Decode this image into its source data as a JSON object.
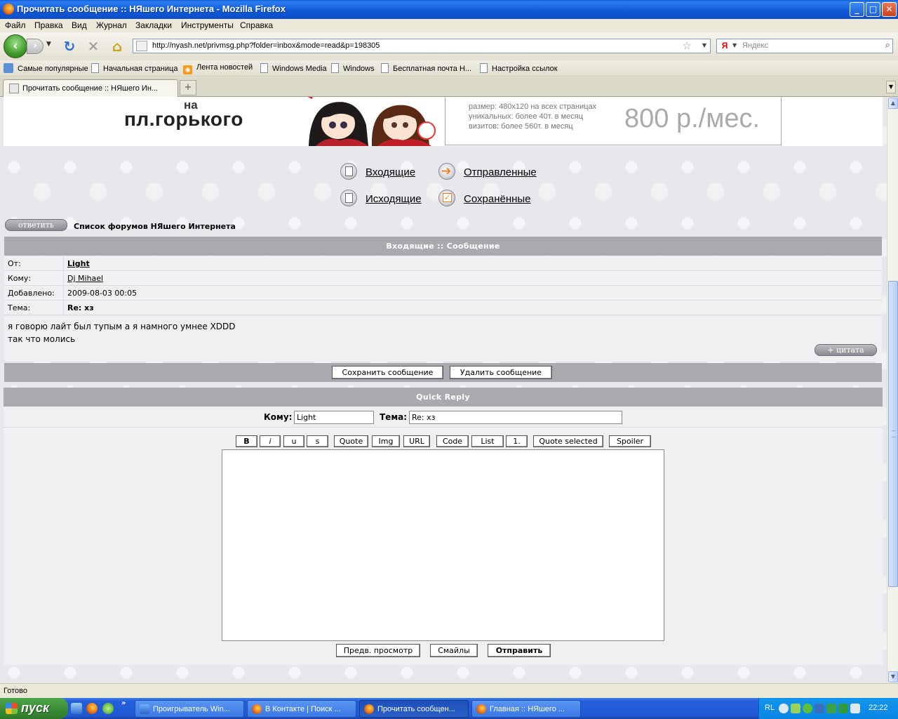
{
  "window": {
    "title": "Прочитать сообщение :: НЯшего Интернета - Mozilla Firefox",
    "min": "_",
    "max": "□",
    "close": "✕"
  },
  "menu": [
    "Файл",
    "Правка",
    "Вид",
    "Журнал",
    "Закладки",
    "Инструменты",
    "Справка"
  ],
  "nav": {
    "url": "http://nyash.net/privmsg.php?folder=inbox&mode=read&p=198305",
    "search_placeholder": "Яндекс",
    "search_engine": "Я"
  },
  "bookmarks": [
    "Самые популярные",
    "Начальная страница",
    "Лента новостей",
    "Windows Media",
    "Windows",
    "Бесплатная почта Н...",
    "Настройка ссылок"
  ],
  "tab": {
    "title": "Прочитать сообщение :: НЯшего Ин...",
    "new_tab": "+"
  },
  "banner": {
    "na": "на",
    "place": "пл.горького",
    "ad_lines": [
      "размер: 480x120 на всех страницах",
      "уникальных: более 40т. в месяц",
      "визитов: более 560т. в месяц"
    ],
    "price": "800 р./мес."
  },
  "folders": {
    "inbox": "Входящие",
    "sent": "Отправленные",
    "outbox": "Исходящие",
    "saved": "Сохранённые"
  },
  "reply_button": "ответить",
  "forum_index": "Список форумов НЯшего Интернета",
  "message": {
    "header": "Входящие :: Сообщение",
    "from_label": "От:",
    "from": "Light",
    "to_label": "Кому:",
    "to": "Dj Mihael",
    "date_label": "Добавлено:",
    "date": "2009-08-03 00:05",
    "subject_label": "Тема:",
    "subject": "Re: хз",
    "body": [
      "я говорю лайт был тупым а я намного умнее XDDD",
      "так что молись"
    ],
    "quote_button": "+ цитата",
    "save_button": "Сохранить сообщение",
    "delete_button": "Удалить сообщение"
  },
  "quick_reply": {
    "header": "Quick Reply",
    "to_label": "Кому:",
    "to_value": "Light",
    "subject_label": "Тема:",
    "subject_value": "Re: хз",
    "bbcode": [
      "B",
      "i",
      "u",
      "s",
      "Quote",
      "Img",
      "URL",
      "Code",
      "List",
      "1.",
      "Quote selected",
      "Spoiler"
    ],
    "preview_button": "Предв. просмотр",
    "smilies_button": "Смайлы",
    "send_button": "Отправить"
  },
  "status": "Готово",
  "taskbar": {
    "start": "пуск",
    "more": "»",
    "tasks": [
      "Проигрыватель Win...",
      "В Контакте | Поиск ...",
      "Прочитать сообщен...",
      "Главная :: НЯшего ..."
    ],
    "lang": "RL",
    "clock": "22:22"
  },
  "colors": {
    "header_bg": "#aba9b0",
    "panel_bg": "#f0eff2",
    "titlebar": "#0c4fc8",
    "taskbar": "#245edb"
  }
}
